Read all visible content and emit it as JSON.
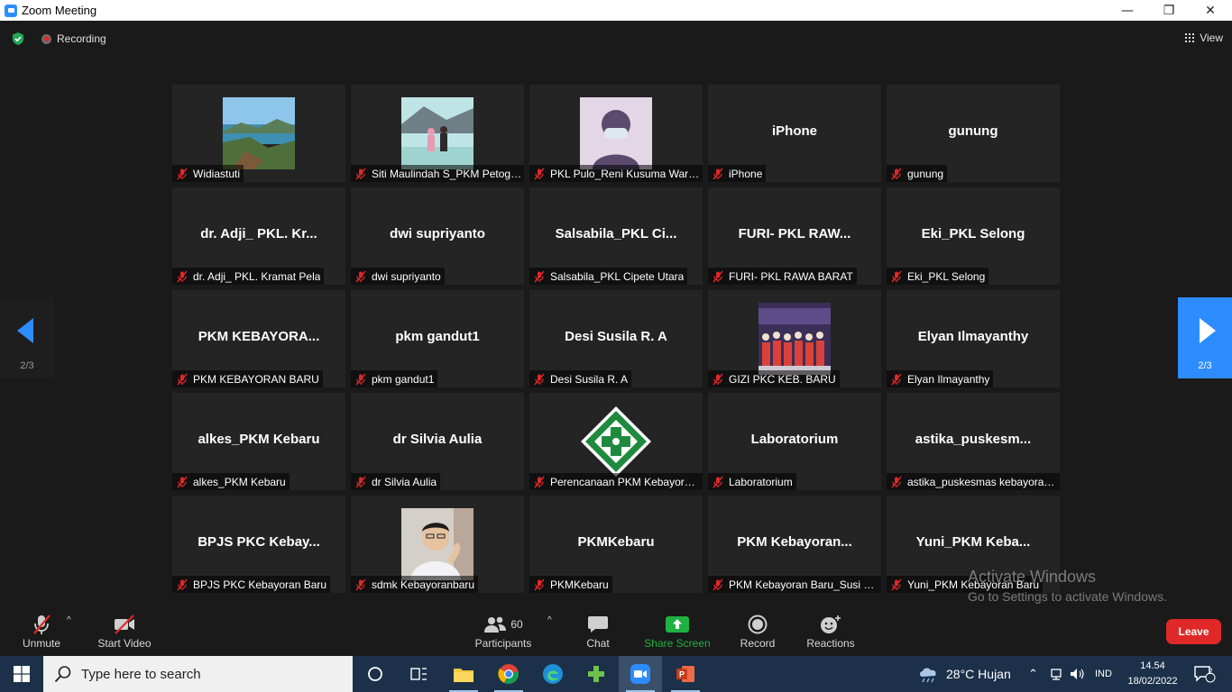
{
  "window": {
    "title": "Zoom Meeting",
    "minimize": "—",
    "maximize": "❐",
    "close": "✕"
  },
  "topbar": {
    "recording_label": "Recording",
    "view_label": "View"
  },
  "tiles": [
    {
      "big": "",
      "name": "Widiastuti",
      "thumb": "landscape"
    },
    {
      "big": "",
      "name": "Siti Maulindah S_PKM Petogogan",
      "thumb": "couple"
    },
    {
      "big": "",
      "name": "PKL Pulo_Reni Kusuma Wardani",
      "thumb": "avatar-mask"
    },
    {
      "big": "iPhone",
      "name": "iPhone",
      "thumb": ""
    },
    {
      "big": "gunung",
      "name": "gunung",
      "thumb": ""
    },
    {
      "big": "dr. Adji_ PKL. Kr...",
      "name": "dr. Adji_ PKL. Kramat Pela",
      "thumb": ""
    },
    {
      "big": "dwi supriyanto",
      "name": "dwi supriyanto",
      "thumb": ""
    },
    {
      "big": "Salsabila_PKL  Ci...",
      "name": "Salsabila_PKL Cipete Utara",
      "thumb": ""
    },
    {
      "big": "FURI- PKL RAW...",
      "name": "FURI- PKL RAWA BARAT",
      "thumb": ""
    },
    {
      "big": "Eki_PKL Selong",
      "name": "Eki_PKL Selong",
      "thumb": ""
    },
    {
      "big": "PKM  KEBAYORA...",
      "name": "PKM KEBAYORAN BARU",
      "thumb": ""
    },
    {
      "big": "pkm gandut1",
      "name": "pkm gandut1",
      "thumb": ""
    },
    {
      "big": "Desi Susila R. A",
      "name": "Desi Susila R. A",
      "thumb": ""
    },
    {
      "big": "",
      "name": "GIZI PKC KEB. BARU",
      "thumb": "group-photo"
    },
    {
      "big": "Elyan Ilmayanthy",
      "name": "Elyan Ilmayanthy",
      "thumb": ""
    },
    {
      "big": "alkes_PKM Kebaru",
      "name": "alkes_PKM Kebaru",
      "thumb": ""
    },
    {
      "big": "dr Silvia Aulia",
      "name": "dr Silvia Aulia",
      "thumb": ""
    },
    {
      "big": "",
      "name": "Perencanaan PKM Kebayoran Baru",
      "thumb": "logo-badge"
    },
    {
      "big": "Laboratorium",
      "name": "Laboratorium",
      "thumb": ""
    },
    {
      "big": "astika_puskesm...",
      "name": "astika_puskesmas kebayoran baru",
      "thumb": ""
    },
    {
      "big": "BPJS PKC Kebay...",
      "name": "BPJS PKC Kebayoran Baru",
      "thumb": ""
    },
    {
      "big": "",
      "name": "sdmk Kebayoranbaru",
      "thumb": "portrait"
    },
    {
      "big": "PKMKebaru",
      "name": "PKMKebaru",
      "thumb": ""
    },
    {
      "big": "PKM  Kebayoran...",
      "name": "PKM Kebayoran Baru_Susi Hartati",
      "thumb": ""
    },
    {
      "big": "Yuni_PKM  Keba...",
      "name": "Yuni_PKM Kebayoran Baru",
      "thumb": ""
    }
  ],
  "pager": {
    "left": "2/3",
    "right": "2/3"
  },
  "watermark": {
    "line1": "Activate Windows",
    "line2": "Go to Settings to activate Windows."
  },
  "toolbar": {
    "unmute": "Unmute",
    "start_video": "Start Video",
    "participants": "Participants",
    "participants_count": "60",
    "chat": "Chat",
    "share_screen": "Share Screen",
    "record": "Record",
    "reactions": "Reactions",
    "leave": "Leave"
  },
  "taskbar": {
    "search_placeholder": "Type here to search",
    "weather": "28°C  Hujan",
    "lang": "IND",
    "time": "14.54",
    "date": "18/02/2022",
    "notifications": "2"
  },
  "colors": {
    "accent": "#2d8cff",
    "leave": "#e02828",
    "share": "#1fb141",
    "muted": "#e02828"
  }
}
